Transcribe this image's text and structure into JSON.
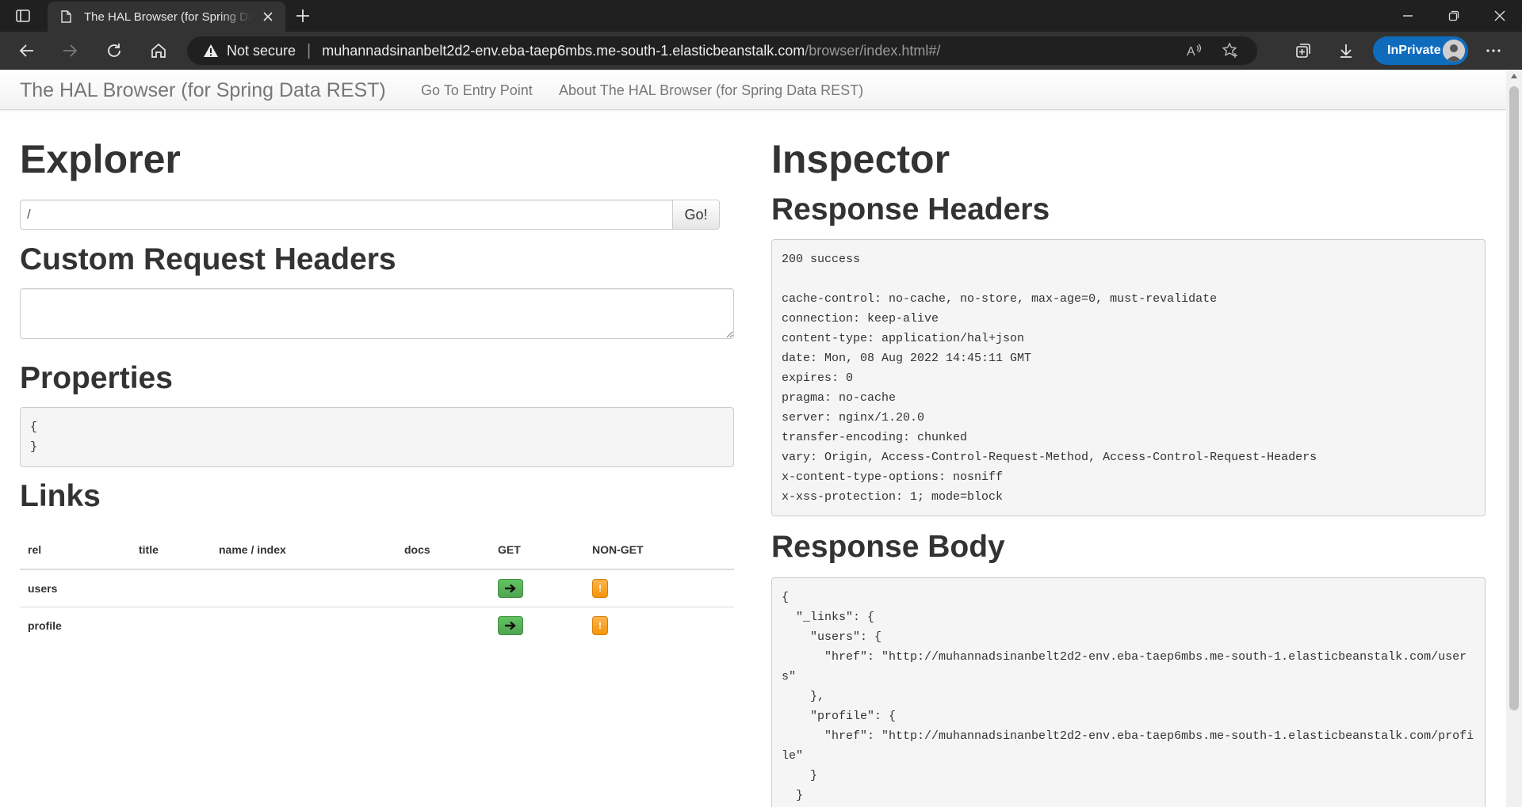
{
  "browser": {
    "tab_title": "The HAL Browser (for Spring Data REST)",
    "not_secure": "Not secure",
    "url_host": "muhannadsinanbelt2d2-env.eba-taep6mbs.me-south-1.elasticbeanstalk.com",
    "url_path": "/browser/index.html#/",
    "inprivate_label": "InPrivate"
  },
  "navbar": {
    "brand": "The HAL Browser (for Spring Data REST)",
    "entry_point": "Go To Entry Point",
    "about": "About The HAL Browser (for Spring Data REST)"
  },
  "explorer": {
    "title": "Explorer",
    "url_value": "/",
    "go_label": "Go!",
    "custom_headers_title": "Custom Request Headers",
    "properties_title": "Properties",
    "properties_body": "{\n}",
    "links_title": "Links",
    "links_table": {
      "columns": [
        "rel",
        "title",
        "name / index",
        "docs",
        "GET",
        "NON-GET"
      ],
      "rows": [
        {
          "rel": "users",
          "title": "",
          "name": "",
          "docs": ""
        },
        {
          "rel": "profile",
          "title": "",
          "name": "",
          "docs": ""
        }
      ],
      "nonget_glyph": "!"
    }
  },
  "inspector": {
    "title": "Inspector",
    "response_headers_title": "Response Headers",
    "response_headers": "200 success\n\ncache-control: no-cache, no-store, max-age=0, must-revalidate\nconnection: keep-alive\ncontent-type: application/hal+json\ndate: Mon, 08 Aug 2022 14:45:11 GMT\nexpires: 0\npragma: no-cache\nserver: nginx/1.20.0\ntransfer-encoding: chunked\nvary: Origin, Access-Control-Request-Method, Access-Control-Request-Headers\nx-content-type-options: nosniff\nx-xss-protection: 1; mode=block",
    "response_body_title": "Response Body",
    "response_body": "{\n  \"_links\": {\n    \"users\": {\n      \"href\": \"http://muhannadsinanbelt2d2-env.eba-taep6mbs.me-south-1.elasticbeanstalk.com/user\ns\"\n    },\n    \"profile\": {\n      \"href\": \"http://muhannadsinanbelt2d2-env.eba-taep6mbs.me-south-1.elasticbeanstalk.com/profi\nle\"\n    }\n  }\n}"
  },
  "colors": {
    "accent": "#0f6cbd",
    "get_button": "#51a351",
    "nonget_button": "#f89406"
  }
}
